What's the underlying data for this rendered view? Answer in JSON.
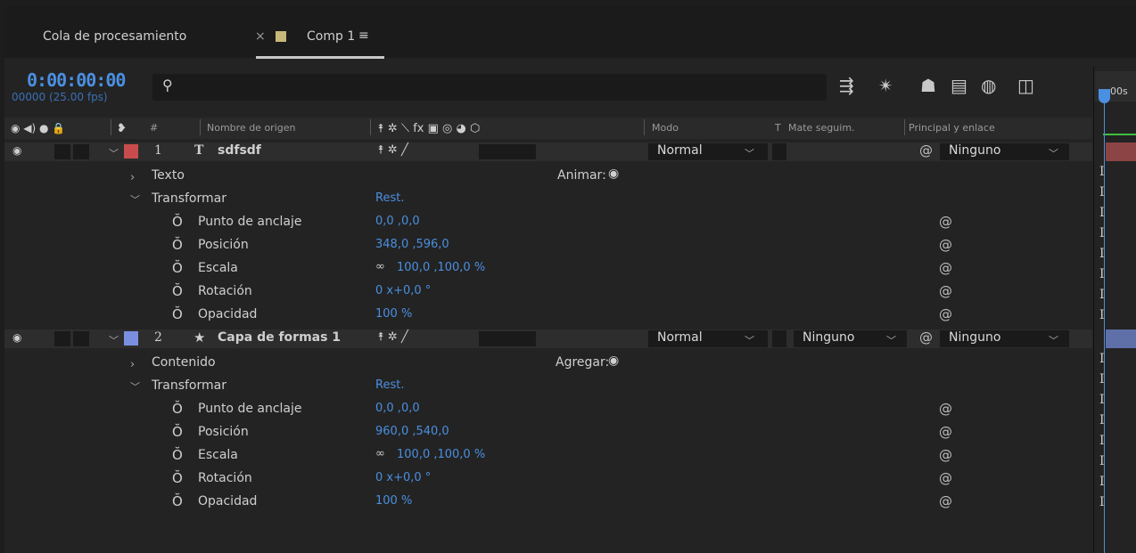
{
  "tabs": [
    {
      "label": "Cola de procesamiento"
    },
    {
      "label": "Comp 1",
      "close": "×",
      "menu": "≡",
      "swatch": "#c8b77a"
    }
  ],
  "timecode": "0:00:00:00",
  "frames_fps": "00000 (25.00 fps)",
  "search": {
    "placeholder": ""
  },
  "columns": {
    "source_name": "Nombre de origen",
    "switches": "⯭ ✲ ⟍ fx ▣ ◎ ◕ ⬡",
    "mode": "Modo",
    "t": "T",
    "trkmat": "Mate seguim.",
    "parent": "Principal y enlace",
    "num_sym": "#"
  },
  "timeline": {
    "ruler_label": "00s"
  },
  "layers": [
    {
      "number": "1",
      "type_icon": "T",
      "name": "sdfsdf",
      "label_color": "#c94c4c",
      "mode": "Normal",
      "trkmat": "",
      "parent": "Ninguno",
      "group1": {
        "label": "Texto",
        "action": "Animar:"
      },
      "group2": {
        "label": "Transformar",
        "reset": "Rest."
      },
      "props": [
        {
          "label": "Punto de anclaje",
          "value": "0,0 ,0,0"
        },
        {
          "label": "Posición",
          "value": "348,0 ,596,0"
        },
        {
          "label": "Escala",
          "value": "100,0 ,100,0 %",
          "link": true
        },
        {
          "label": "Rotación",
          "value": "0 x+0,0 °"
        },
        {
          "label": "Opacidad",
          "value": "100 %"
        }
      ]
    },
    {
      "number": "2",
      "type_icon": "★",
      "name": "Capa de formas 1",
      "label_color": "#7a8fe0",
      "mode": "Normal",
      "trkmat": "Ninguno",
      "parent": "Ninguno",
      "group1": {
        "label": "Contenido",
        "action": "Agregar:"
      },
      "group2": {
        "label": "Transformar",
        "reset": "Rest."
      },
      "props": [
        {
          "label": "Punto de anclaje",
          "value": "0,0 ,0,0"
        },
        {
          "label": "Posición",
          "value": "960,0 ,540,0"
        },
        {
          "label": "Escala",
          "value": "100,0 ,100,0 %",
          "link": true
        },
        {
          "label": "Rotación",
          "value": "0 x+0,0 °"
        },
        {
          "label": "Opacidad",
          "value": "100 %"
        }
      ]
    }
  ]
}
